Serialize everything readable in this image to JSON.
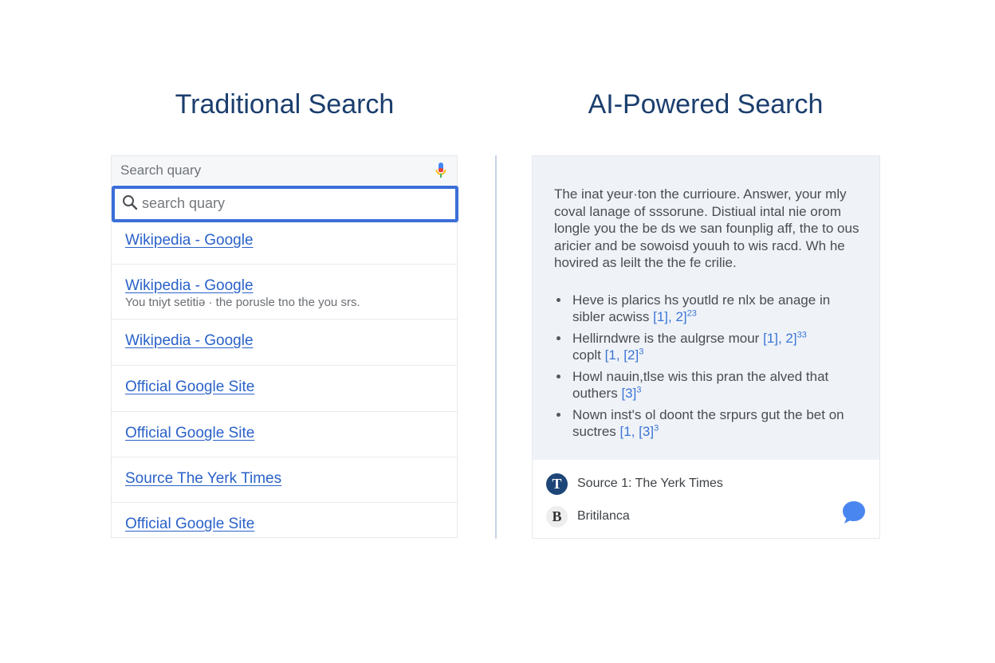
{
  "headings": {
    "left": "Traditional Search",
    "right": "AI-Powered Search"
  },
  "traditional": {
    "top_placeholder": "Search quary",
    "search_placeholder": "search quary",
    "results": [
      {
        "title": "Wikipedia - Google",
        "snippet": ""
      },
      {
        "title": "Wikipedia - Google",
        "snippet": "You tniyt setitiə · the porusle tno the you srs."
      },
      {
        "title": "Wikipedia - Google",
        "snippet": ""
      },
      {
        "title": "Official Google Site",
        "snippet": ""
      },
      {
        "title": "Official Google Site",
        "snippet": ""
      },
      {
        "title": "Source  The Yerk Times",
        "snippet": ""
      },
      {
        "title": "Official Google Site",
        "snippet": ""
      }
    ]
  },
  "ai": {
    "paragraph": "The inat yeur·ton the currioure. Answer, your mly coval lanage of sssorune. Distiual intal nie orom longle you the be ds we san founplig aff, the to ous aricier and be sowoisd youuh to wis racd. Wh he hovired as leilt the the fe crilie.",
    "bullets": [
      {
        "text": "Heve is plarics hs youtld re nlx be anage in sibler acwiss",
        "cite": "[1], 2]",
        "sup": "23"
      },
      {
        "text": "Hellirndwre is the aulgrse mour",
        "cite": "[1], 2]",
        "sup": "33",
        "text2": "coplt",
        "cite2": "[1, [2]",
        "sup2": "3"
      },
      {
        "text": "Howl nauin,tlse wis this pran the alved that outhers",
        "cite": "[3]",
        "sup": "3"
      },
      {
        "text": "Nown inst's ol doont the srpurs gut the bet on suctres",
        "cite": "[1, [3]",
        "sup": "3"
      }
    ],
    "sources": [
      {
        "badge": "T",
        "label": "Source 1: The Yerk Times"
      },
      {
        "badge": "B",
        "label": "Britilanca"
      }
    ]
  },
  "colors": {
    "heading": "#1b3e6e",
    "link": "#2a62c9",
    "search_border": "#3b6fd8",
    "answer_bg": "#eff3f8",
    "chat_icon": "#4a86f0"
  }
}
